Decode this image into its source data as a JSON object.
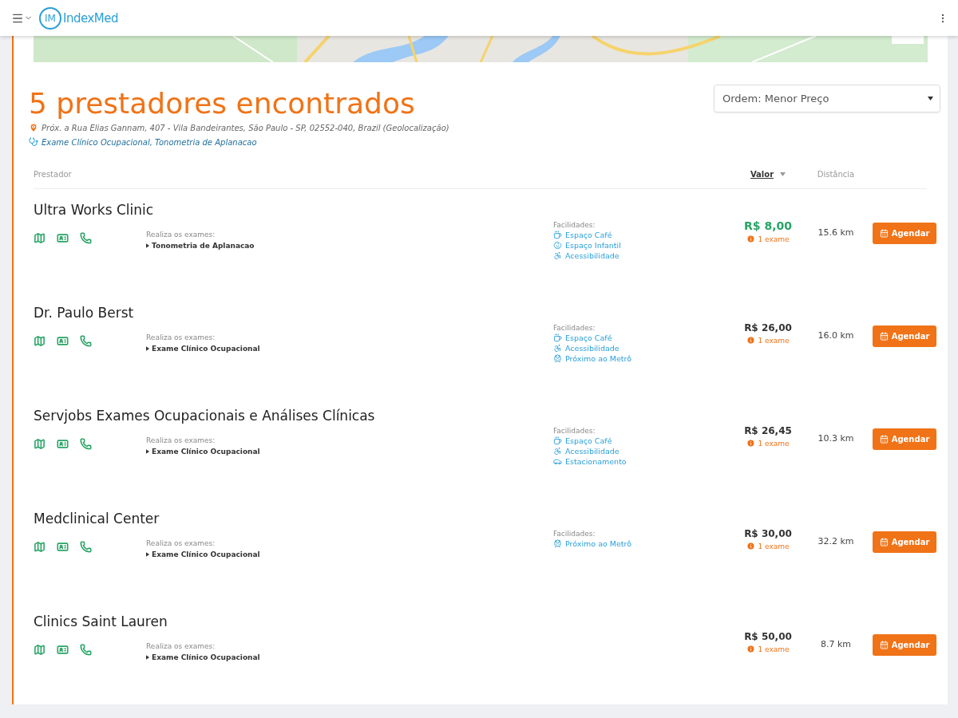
{
  "header": {
    "logo_mark": "IM",
    "logo_text": "IndexMed"
  },
  "results": {
    "title": "5 prestadores encontrados",
    "address": "Próx. a Rua Elias Gannam, 407 - Vila Bandeirantes, São Paulo - SP, 02552-040, Brazil (Geolocalização)",
    "exams": "Exame Clínico Ocupacional, Tonometria de Aplanacao",
    "sort": "Ordem: Menor Preço"
  },
  "columns": {
    "provider": "Prestador",
    "value": "Valor",
    "distance": "Distância"
  },
  "providers": [
    {
      "name": "Ultra Works Clinic",
      "exams_label": "Realiza os exames:",
      "exams": [
        "Tonometria de Aplanacao"
      ],
      "facilities_label": "Facilidades:",
      "facilities": [
        {
          "kind": "cafe",
          "label": "Espaço Café"
        },
        {
          "kind": "child",
          "label": "Espaço Infantil"
        },
        {
          "kind": "access",
          "label": "Acessibilidade"
        }
      ],
      "price": "R$ 8,00",
      "highlight": true,
      "exam_count": "1 exame",
      "distance": "15.6 km",
      "button": "Agendar"
    },
    {
      "name": "Dr. Paulo Berst",
      "exams_label": "Realiza os exames:",
      "exams": [
        "Exame Clínico Ocupacional"
      ],
      "facilities_label": "Facilidades:",
      "facilities": [
        {
          "kind": "cafe",
          "label": "Espaço Café"
        },
        {
          "kind": "access",
          "label": "Acessibilidade"
        },
        {
          "kind": "metro",
          "label": "Próximo ao Metrô"
        }
      ],
      "price": "R$ 26,00",
      "highlight": false,
      "exam_count": "1 exame",
      "distance": "16.0 km",
      "button": "Agendar"
    },
    {
      "name": "Servjobs Exames Ocupacionais e Análises Clínicas",
      "exams_label": "Realiza os exames:",
      "exams": [
        "Exame Clínico Ocupacional"
      ],
      "facilities_label": "Facilidades:",
      "facilities": [
        {
          "kind": "cafe",
          "label": "Espaço Café"
        },
        {
          "kind": "access",
          "label": "Acessibilidade"
        },
        {
          "kind": "parking",
          "label": "Estacionamento"
        }
      ],
      "price": "R$ 26,45",
      "highlight": false,
      "exam_count": "1 exame",
      "distance": "10.3 km",
      "button": "Agendar"
    },
    {
      "name": "Medclinical Center",
      "exams_label": "Realiza os exames:",
      "exams": [
        "Exame Clínico Ocupacional"
      ],
      "facilities_label": "Facilidades:",
      "facilities": [
        {
          "kind": "metro",
          "label": "Próximo ao Metrô"
        }
      ],
      "price": "R$ 30,00",
      "highlight": false,
      "exam_count": "1 exame",
      "distance": "32.2 km",
      "button": "Agendar"
    },
    {
      "name": "Clinics Saint Lauren",
      "exams_label": "Realiza os exames:",
      "exams": [
        "Exame Clínico Ocupacional"
      ],
      "price": "R$ 50,00",
      "highlight": false,
      "exam_count": "1 exame",
      "distance": "8.7 km",
      "button": "Agendar"
    }
  ]
}
